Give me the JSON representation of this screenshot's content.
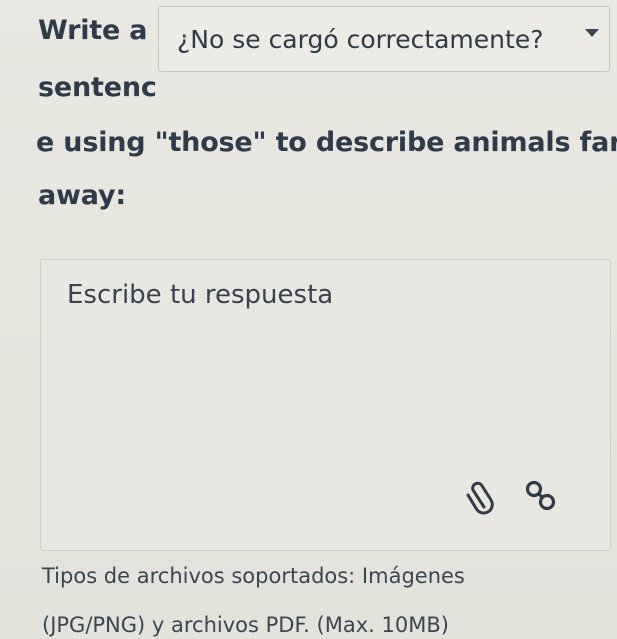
{
  "question": {
    "lines": [
      "Write a",
      "sentenc",
      "e using \"those\" to describe animals far",
      "away:"
    ]
  },
  "dropdown": {
    "label": "¿No se cargó correctamente?"
  },
  "answer": {
    "placeholder": "Escribe tu respuesta"
  },
  "toolbar": {
    "attach_icon": "paperclip-icon",
    "link_icon": "link-icon"
  },
  "file_info": {
    "lines": [
      "Tipos de archivos soportados: Imágenes",
      "(JPG/PNG) y archivos PDF. (Max. 10MB)"
    ]
  }
}
